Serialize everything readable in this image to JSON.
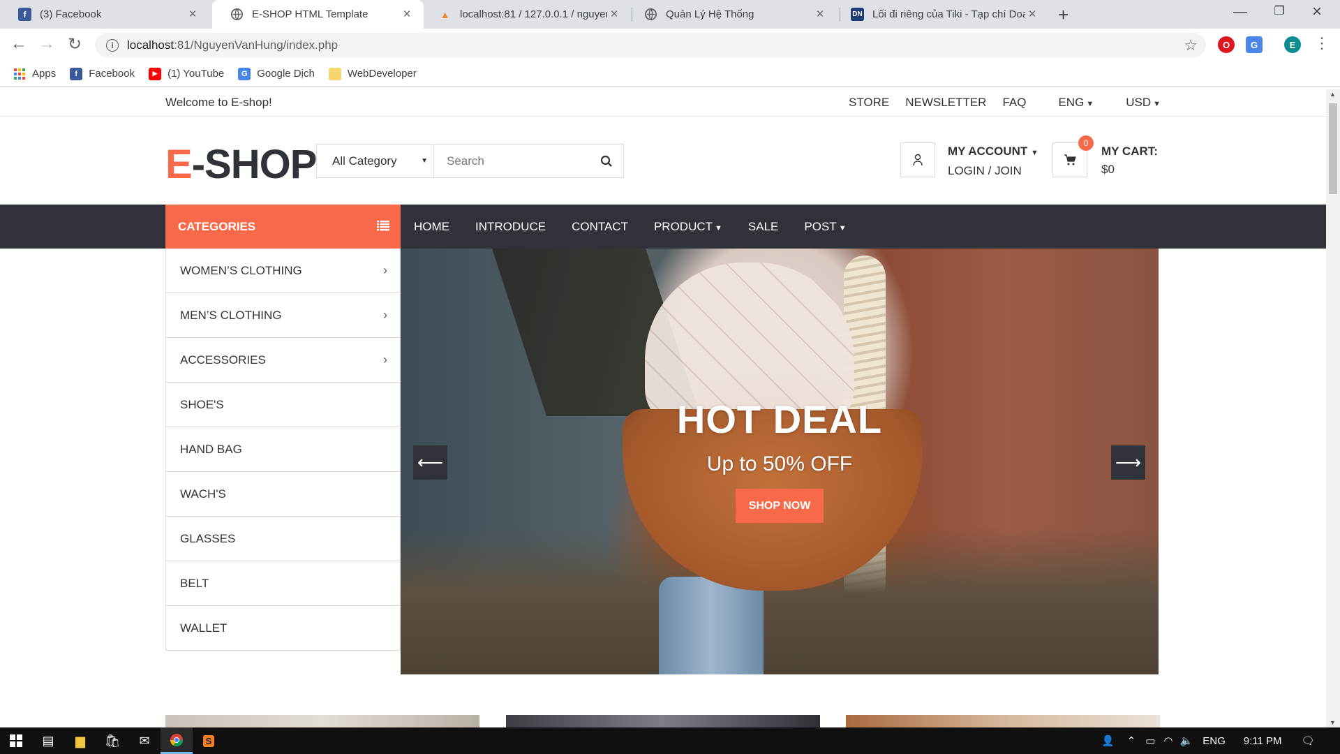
{
  "browser": {
    "tabs": [
      {
        "title": "(3) Facebook",
        "icon": "facebook-icon",
        "active": false
      },
      {
        "title": "E-SHOP HTML Template",
        "icon": "globe-icon",
        "active": true
      },
      {
        "title": "localhost:81 / 127.0.0.1 / nguyen",
        "icon": "phpmyadmin-icon",
        "active": false
      },
      {
        "title": "Quản Lý Hệ Thống",
        "icon": "globe-icon",
        "active": false
      },
      {
        "title": "Lối đi riêng của Tiki - Tạp chí Doa",
        "icon": "dn-icon",
        "active": false
      }
    ],
    "url_host": "localhost",
    "url_rest": ":81/NguyenVanHung/index.php",
    "profile_initial": "E",
    "bookmarks": [
      {
        "label": "Apps",
        "icon": "apps-grid-icon"
      },
      {
        "label": "Facebook",
        "icon": "facebook-icon"
      },
      {
        "label": "(1) YouTube",
        "icon": "youtube-icon"
      },
      {
        "label": "Google Dịch",
        "icon": "google-translate-icon"
      },
      {
        "label": "WebDeveloper",
        "icon": "folder-icon"
      }
    ]
  },
  "topheader": {
    "welcome": "Welcome to E-shop!",
    "links": [
      "STORE",
      "NEWSLETTER",
      "FAQ",
      "ENG",
      "USD"
    ]
  },
  "header": {
    "logo_accent": "E",
    "logo_rest": "-SHOP",
    "category_select": "All Category",
    "search_placeholder": "Search",
    "account_title": "MY ACCOUNT",
    "account_links": "LOGIN / JOIN",
    "cart_title": "MY CART:",
    "cart_total": "$0",
    "cart_count": "0"
  },
  "nav": {
    "categories_label": "CATEGORIES",
    "menu": [
      {
        "label": "HOME",
        "dropdown": false
      },
      {
        "label": "INTRODUCE",
        "dropdown": false
      },
      {
        "label": "CONTACT",
        "dropdown": false
      },
      {
        "label": "PRODUCT",
        "dropdown": true
      },
      {
        "label": "SALE",
        "dropdown": false
      },
      {
        "label": "POST",
        "dropdown": true
      }
    ]
  },
  "categories": [
    {
      "label": "WOMEN’S CLOTHING",
      "has_sub": true
    },
    {
      "label": "MEN’S CLOTHING",
      "has_sub": true
    },
    {
      "label": "ACCESSORIES",
      "has_sub": true
    },
    {
      "label": "SHOE'S",
      "has_sub": false
    },
    {
      "label": "HAND BAG",
      "has_sub": false
    },
    {
      "label": "WACH'S",
      "has_sub": false
    },
    {
      "label": "GLASSES",
      "has_sub": false
    },
    {
      "label": "BELT",
      "has_sub": false
    },
    {
      "label": "WALLET",
      "has_sub": false
    }
  ],
  "hero": {
    "title": "HOT DEAL",
    "subtitle": "Up to 50% OFF",
    "button": "SHOP NOW"
  },
  "taskbar": {
    "language": "ENG",
    "time": "9:11 PM"
  },
  "colors": {
    "accent": "#f8694a",
    "nav_dark": "#30323a",
    "text": "#333333"
  }
}
